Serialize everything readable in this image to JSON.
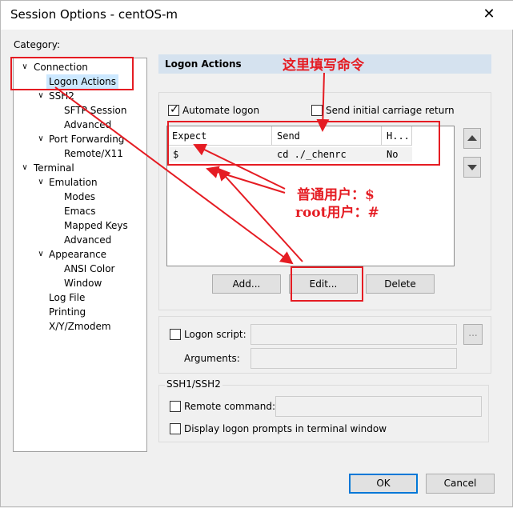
{
  "window": {
    "title": "Session Options - centOS-m",
    "close_glyph": "✕"
  },
  "category": {
    "label": "Category:",
    "tree": [
      {
        "label": "Connection",
        "expanded": true
      },
      {
        "label": "Logon Actions",
        "selected": true
      },
      {
        "label": "SSH2",
        "expanded": true
      },
      {
        "label": "SFTP Session"
      },
      {
        "label": "Advanced"
      },
      {
        "label": "Port Forwarding",
        "expanded": true
      },
      {
        "label": "Remote/X11"
      },
      {
        "label": "Terminal",
        "expanded": true
      },
      {
        "label": "Emulation",
        "expanded": true
      },
      {
        "label": "Modes"
      },
      {
        "label": "Emacs"
      },
      {
        "label": "Mapped Keys"
      },
      {
        "label": "Advanced"
      },
      {
        "label": "Appearance",
        "expanded": true
      },
      {
        "label": "ANSI Color"
      },
      {
        "label": "Window"
      },
      {
        "label": "Log File"
      },
      {
        "label": "Printing"
      },
      {
        "label": "X/Y/Zmodem"
      }
    ]
  },
  "panel": {
    "header": "Logon Actions",
    "automate_logon": {
      "label": "Automate logon",
      "checked": true
    },
    "send_initial_cr": {
      "label": "Send initial carriage return",
      "checked": false
    },
    "table": {
      "columns": [
        "Expect",
        "Send",
        "H..."
      ],
      "rows": [
        {
          "expect": "$",
          "send": "cd ./_chenrc",
          "hide": "No"
        }
      ]
    },
    "buttons": {
      "add": "Add...",
      "edit": "Edit...",
      "delete": "Delete",
      "browse": "..."
    },
    "logon_script": {
      "label": "Logon script:",
      "value": ""
    },
    "arguments": {
      "label": "Arguments:",
      "value": ""
    },
    "ssh_group": {
      "title": "SSH1/SSH2",
      "remote_command": {
        "label": "Remote command:",
        "value": ""
      },
      "display_prompts": {
        "label": "Display logon prompts in terminal window"
      }
    }
  },
  "footer": {
    "ok": "OK",
    "cancel": "Cancel"
  },
  "annotations": {
    "fill_command": "这里填写命令",
    "normal_user": "普通用户：$",
    "root_user": "root用户：#",
    "color": "#e51c23"
  },
  "icons": {
    "check": "✓",
    "expand": "∨"
  }
}
